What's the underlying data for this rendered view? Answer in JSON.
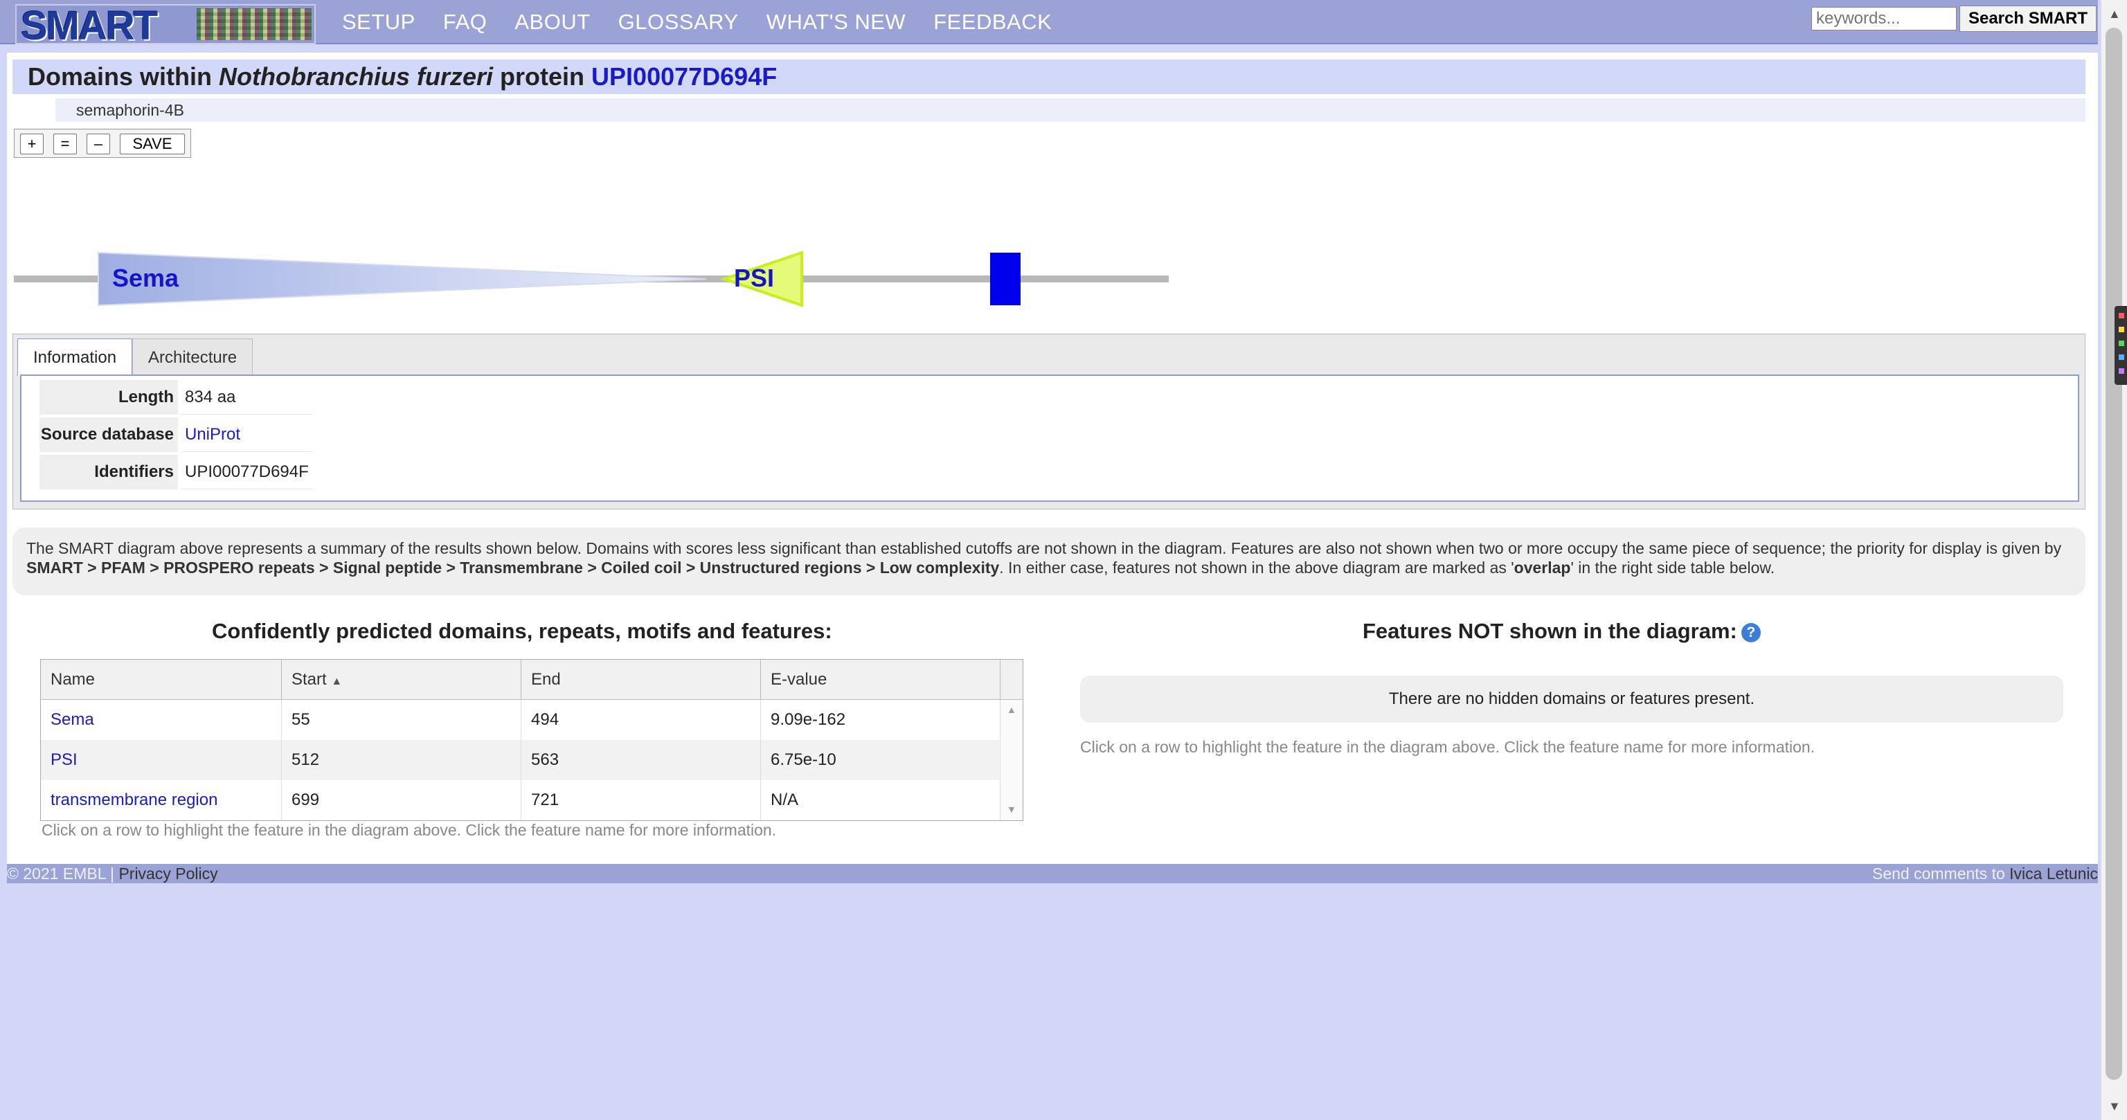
{
  "header": {
    "logo_text": "SMART",
    "nav": [
      "SETUP",
      "FAQ",
      "ABOUT",
      "GLOSSARY",
      "WHAT'S NEW",
      "FEEDBACK"
    ],
    "search_placeholder": "keywords...",
    "search_button": "Search SMART"
  },
  "page": {
    "title_prefix": "Domains within ",
    "species": "Nothobranchius furzeri",
    "title_mid": " protein ",
    "protein_id": "UPI00077D694F",
    "subtitle": "semaphorin-4B"
  },
  "zoom_controls": {
    "plus": "+",
    "reset": "=",
    "minus": "–",
    "save": "SAVE"
  },
  "diagram": {
    "protein_length": 834,
    "domains": [
      {
        "name": "Sema",
        "start": 55,
        "end": 494,
        "shape": "wedge",
        "color": "#b7c3ea"
      },
      {
        "name": "PSI",
        "start": 512,
        "end": 563,
        "shape": "left-arrow",
        "color": "#e6fa7a"
      },
      {
        "name": "",
        "start": 699,
        "end": 721,
        "shape": "bar",
        "color": "#0000ee"
      }
    ],
    "ruler_ticks": [
      "0",
      "100",
      "200",
      "300",
      "400",
      "500",
      "600",
      "700",
      "800"
    ]
  },
  "tabs": {
    "information": "Information",
    "architecture": "Architecture"
  },
  "info": [
    {
      "label": "Length",
      "value": "834 aa",
      "link": false
    },
    {
      "label": "Source database",
      "value": "UniProt",
      "link": true
    },
    {
      "label": "Identifiers",
      "value": "UPI00077D694F",
      "link": false
    }
  ],
  "explanation": {
    "text1": "The SMART diagram above represents a summary of the results shown below. Domains with scores less significant than established cutoffs are not shown in the diagram. Features are also not shown when two or more occupy the same piece of sequence; the priority for display is given by ",
    "priority": "SMART > PFAM > PROSPERO repeats > Signal peptide > Transmembrane > Coiled coil > Unstructured regions > Low complexity",
    "text2": ". In either case, features not shown in the above diagram are marked as '",
    "overlap": "overlap",
    "text3": "' in the right side table below."
  },
  "predicted": {
    "heading": "Confidently predicted domains, repeats, motifs and features:",
    "columns": [
      "Name",
      "Start",
      "End",
      "E-value"
    ],
    "sort_indicator": "▲",
    "rows": [
      {
        "name": "Sema",
        "start": "55",
        "end": "494",
        "evalue": "9.09e-162"
      },
      {
        "name": "PSI",
        "start": "512",
        "end": "563",
        "evalue": "6.75e-10"
      },
      {
        "name": "transmembrane region",
        "start": "699",
        "end": "721",
        "evalue": "N/A"
      }
    ],
    "hint": "Click on a row to highlight the feature in the diagram above. Click the feature name for more information."
  },
  "hidden": {
    "heading": "Features NOT shown in the diagram:",
    "help_icon": "?",
    "message": "There are no hidden domains or features present.",
    "hint": "Click on a row to highlight the feature in the diagram above. Click the feature name for more information."
  },
  "footer": {
    "copyright": "© 2021 EMBL | ",
    "privacy": "Privacy Policy",
    "comments": "Send comments to ",
    "contact": "Ivica Letunic"
  }
}
